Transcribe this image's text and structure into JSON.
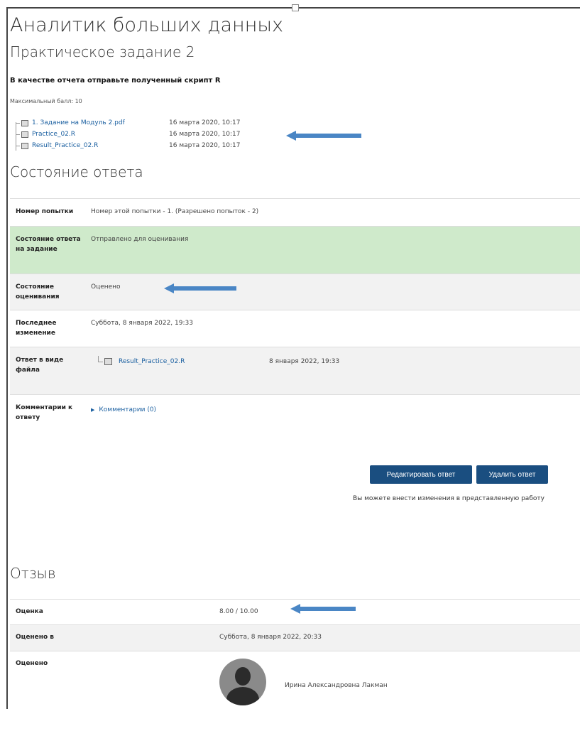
{
  "course_title": "Аналитик больших данных",
  "assignment_title": "Практическое задание 2",
  "intro": "В качестве отчета отправьте полученный скрипт R",
  "max_grade": "Максимальный балл: 10",
  "attachments": [
    {
      "name": "1. Задание на Модуль 2.pdf",
      "date": "16 марта 2020, 10:17"
    },
    {
      "name": "Practice_02.R",
      "date": "16 марта 2020, 10:17"
    },
    {
      "name": "Result_Practice_02.R",
      "date": "16 марта 2020, 10:17"
    }
  ],
  "submission": {
    "title": "Состояние ответа",
    "rows": [
      {
        "label": "Номер попытки",
        "value": "Номер этой попытки - 1. (Разрешено попыток - 2)"
      },
      {
        "label": "Состояние ответа на задание",
        "value": "Отправлено для оценивания"
      },
      {
        "label": "Состояние оценивания",
        "value": "Оценено"
      },
      {
        "label": "Последнее изменение",
        "value": "Суббота, 8 января 2022, 19:33"
      },
      {
        "label": "Ответ в виде файла",
        "file": {
          "name": "Result_Practice_02.R",
          "date": "8 января 2022, 19:33"
        }
      },
      {
        "label": "Комментарии к ответу",
        "comments": "Комментарии (0)"
      }
    ]
  },
  "buttons": {
    "edit": "Редактировать ответ",
    "delete": "Удалить ответ"
  },
  "edit_hint": "Вы можете внести изменения в представленную работу",
  "feedback": {
    "title": "Отзыв",
    "grade_label": "Оценка",
    "grade_value": "8.00 / 10.00",
    "graded_on_label": "Оценено в",
    "graded_on_value": "Суббота, 8 января 2022, 20:33",
    "graded_by_label": "Оценено",
    "grader_name": "Ирина Александровна Лакман"
  },
  "colors": {
    "link": "#1a5fa0",
    "button": "#1a4e80",
    "status_green": "#cfeacb",
    "arrow": "#4a86c5"
  }
}
